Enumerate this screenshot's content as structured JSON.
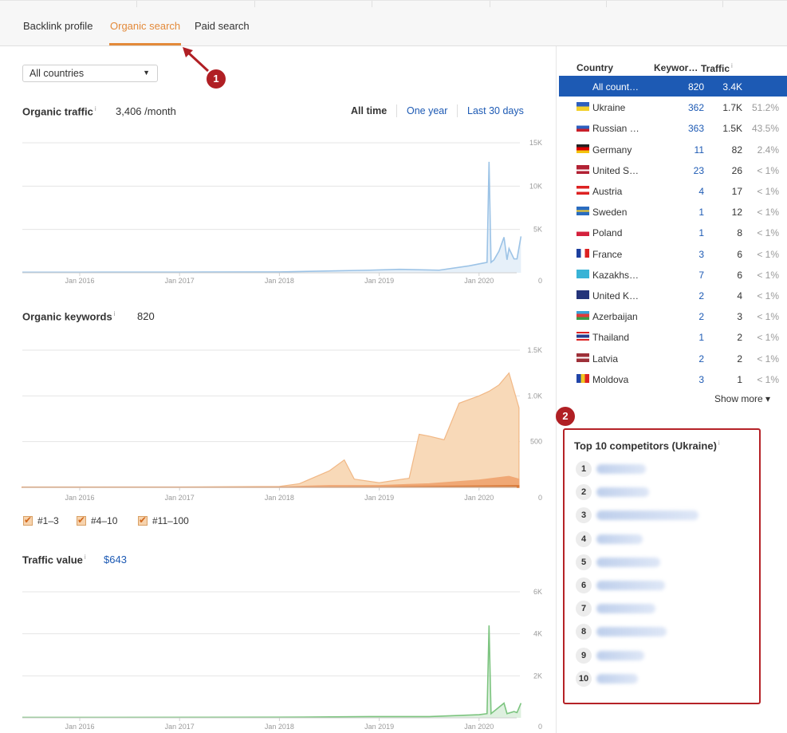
{
  "tabs": [
    {
      "label": "Backlink profile"
    },
    {
      "label": "Organic search"
    },
    {
      "label": "Paid search"
    }
  ],
  "filters": {
    "country_select": "All countries",
    "time_ranges": [
      "All time",
      "One year",
      "Last 30 days"
    ]
  },
  "sections": {
    "organic_traffic": {
      "title": "Organic traffic",
      "info": "i",
      "value": "3,406 /month"
    },
    "organic_keywords": {
      "title": "Organic keywords",
      "info": "i",
      "value": "820"
    },
    "traffic_value": {
      "title": "Traffic value",
      "info": "i",
      "value": "$643"
    }
  },
  "legend": [
    {
      "label": "#1–3"
    },
    {
      "label": "#4–10"
    },
    {
      "label": "#11–100"
    }
  ],
  "chart_data": [
    {
      "type": "line",
      "title": "Organic traffic",
      "x_ticks": [
        "Jan 2016",
        "Jan 2017",
        "Jan 2018",
        "Jan 2019",
        "Jan 2020"
      ],
      "y_ticks": [
        "0",
        "5K",
        "10K",
        "15K"
      ],
      "ylim": [
        0,
        15000
      ],
      "series": [
        {
          "color": "#9cc3e6",
          "x": [
            2015.4,
            2016.0,
            2017.0,
            2018.0,
            2018.9,
            2019.2,
            2019.6,
            2019.9,
            2020.08,
            2020.1,
            2020.12,
            2020.15,
            2020.2,
            2020.25,
            2020.28,
            2020.3,
            2020.35,
            2020.38,
            2020.42
          ],
          "y": [
            60,
            70,
            80,
            100,
            300,
            400,
            300,
            800,
            1200,
            12800,
            1200,
            1500,
            2500,
            4100,
            1500,
            2800,
            1600,
            1600,
            4200
          ]
        }
      ]
    },
    {
      "type": "area",
      "title": "Organic keywords",
      "x_ticks": [
        "Jan 2016",
        "Jan 2017",
        "Jan 2018",
        "Jan 2019",
        "Jan 2020"
      ],
      "y_ticks": [
        "0",
        "500",
        "1.0K",
        "1.5K"
      ],
      "ylim": [
        0,
        1500
      ],
      "series": [
        {
          "name": "#11–100",
          "color": "#f8d9b8",
          "x": [
            2015.4,
            2017.0,
            2018.0,
            2018.2,
            2018.5,
            2018.65,
            2018.75,
            2019.0,
            2019.3,
            2019.4,
            2019.5,
            2019.65,
            2019.8,
            2020.0,
            2020.1,
            2020.2,
            2020.3,
            2020.4
          ],
          "y": [
            5,
            5,
            10,
            40,
            180,
            300,
            90,
            50,
            100,
            580,
            560,
            520,
            920,
            1000,
            1050,
            1120,
            1250,
            870
          ]
        },
        {
          "name": "#4–10",
          "color": "#f0a875",
          "x": [
            2015.4,
            2018.0,
            2018.5,
            2019.0,
            2019.5,
            2020.0,
            2020.3,
            2020.4
          ],
          "y": [
            2,
            4,
            20,
            20,
            40,
            80,
            120,
            90
          ]
        },
        {
          "name": "#1–3",
          "color": "#d97b3a",
          "x": [
            2015.4,
            2018.0,
            2019.0,
            2020.0,
            2020.4
          ],
          "y": [
            1,
            2,
            5,
            15,
            20
          ]
        }
      ]
    },
    {
      "type": "line",
      "title": "Traffic value",
      "x_ticks": [
        "Jan 2016",
        "Jan 2017",
        "Jan 2018",
        "Jan 2019",
        "Jan 2020"
      ],
      "y_ticks": [
        "0",
        "2K",
        "4K",
        "6K"
      ],
      "ylim": [
        0,
        6000
      ],
      "series": [
        {
          "color": "#7cc47f",
          "x": [
            2015.4,
            2018.0,
            2018.9,
            2019.5,
            2020.0,
            2020.08,
            2020.1,
            2020.12,
            2020.25,
            2020.28,
            2020.35,
            2020.38,
            2020.42
          ],
          "y": [
            20,
            30,
            60,
            60,
            150,
            200,
            4400,
            200,
            700,
            200,
            300,
            250,
            700
          ]
        }
      ]
    }
  ],
  "country_table": {
    "headers": {
      "country": "Country",
      "keywords": "Keywor…",
      "traffic": "Traffic",
      "info": "i"
    },
    "rows": [
      {
        "name": "All count…",
        "keywords": "820",
        "traffic": "3.4K",
        "pct": "",
        "flag": "none"
      },
      {
        "name": "Ukraine",
        "keywords": "362",
        "traffic": "1.7K",
        "pct": "51.2%",
        "flag": "ua"
      },
      {
        "name": "Russian …",
        "keywords": "363",
        "traffic": "1.5K",
        "pct": "43.5%",
        "flag": "ru"
      },
      {
        "name": "Germany",
        "keywords": "11",
        "traffic": "82",
        "pct": "2.4%",
        "flag": "de"
      },
      {
        "name": "United S…",
        "keywords": "23",
        "traffic": "26",
        "pct": "< 1%",
        "flag": "us"
      },
      {
        "name": "Austria",
        "keywords": "4",
        "traffic": "17",
        "pct": "< 1%",
        "flag": "at"
      },
      {
        "name": "Sweden",
        "keywords": "1",
        "traffic": "12",
        "pct": "< 1%",
        "flag": "se"
      },
      {
        "name": "Poland",
        "keywords": "1",
        "traffic": "8",
        "pct": "< 1%",
        "flag": "pl"
      },
      {
        "name": "France",
        "keywords": "3",
        "traffic": "6",
        "pct": "< 1%",
        "flag": "fr"
      },
      {
        "name": "Kazakhs…",
        "keywords": "7",
        "traffic": "6",
        "pct": "< 1%",
        "flag": "kz"
      },
      {
        "name": "United K…",
        "keywords": "2",
        "traffic": "4",
        "pct": "< 1%",
        "flag": "gb"
      },
      {
        "name": "Azerbaijan",
        "keywords": "2",
        "traffic": "3",
        "pct": "< 1%",
        "flag": "az"
      },
      {
        "name": "Thailand",
        "keywords": "1",
        "traffic": "2",
        "pct": "< 1%",
        "flag": "th"
      },
      {
        "name": "Latvia",
        "keywords": "2",
        "traffic": "2",
        "pct": "< 1%",
        "flag": "lv"
      },
      {
        "name": "Moldova",
        "keywords": "3",
        "traffic": "1",
        "pct": "< 1%",
        "flag": "md"
      }
    ],
    "show_more": "Show more ▾"
  },
  "competitors": {
    "title": "Top 10 competitors (Ukraine)",
    "info": "i",
    "ranks": [
      "1",
      "2",
      "3",
      "4",
      "5",
      "6",
      "7",
      "8",
      "9",
      "10"
    ]
  },
  "annotations": [
    "1",
    "2"
  ],
  "colors": {
    "accent": "#e38a3a",
    "selected_row": "#1d5ab4",
    "annotation": "#b01f24"
  }
}
